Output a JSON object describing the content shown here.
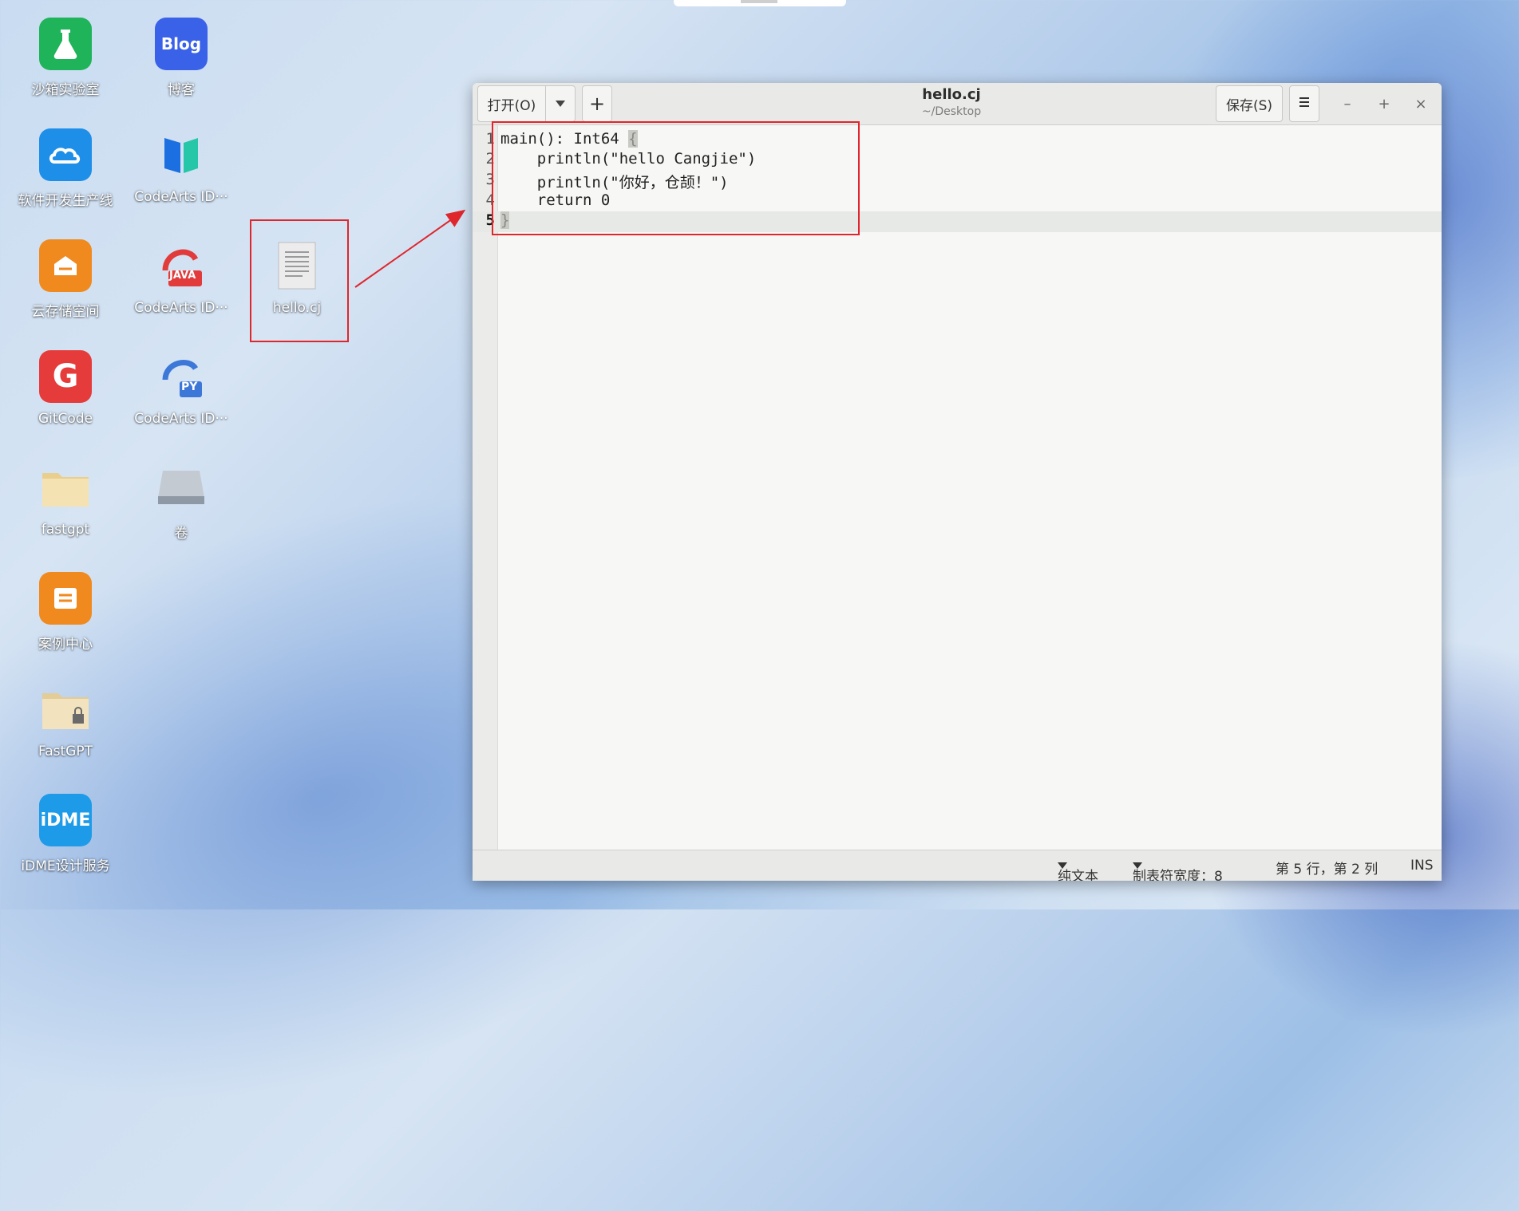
{
  "desktop": {
    "icons": [
      {
        "label": "沙箱实验室",
        "icon": "lab-flask-icon",
        "color": "#1fb35a"
      },
      {
        "label": "博客",
        "icon": "blog-icon",
        "color": "#3a62e8",
        "glyph": "Blog"
      },
      {
        "label": "软件开发生产线",
        "icon": "cloud-devops-icon",
        "color": "#1e8fe8"
      },
      {
        "label": "CodeArts ID···",
        "icon": "codearts-ide-icon",
        "color": "#1fa7d8"
      },
      {
        "label": "云存储空间",
        "icon": "cloud-storage-icon",
        "color": "#f08a1e"
      },
      {
        "label": "CodeArts ID···",
        "icon": "codearts-java-icon",
        "color": "#e83a3a",
        "glyph": "JAVA"
      },
      {
        "label": "hello.cj",
        "icon": "text-file-icon",
        "color": "#e6e6e6"
      },
      {
        "label": "GitCode",
        "icon": "gitcode-icon",
        "color": "#e63b3b",
        "glyph": "G"
      },
      {
        "label": "CodeArts ID···",
        "icon": "codearts-python-icon",
        "color": "#3d78d8",
        "glyph": "PY"
      },
      {
        "label": "fastgpt",
        "icon": "folder-icon",
        "color": "#f1d9a0"
      },
      {
        "label": "卷",
        "icon": "drive-icon",
        "color": "#b9c1c9"
      },
      {
        "label": "案例中心",
        "icon": "case-center-icon",
        "color": "#f08a1e"
      },
      {
        "label": "FastGPT",
        "icon": "locked-folder-icon",
        "color": "#efdcb0"
      },
      {
        "label": "iDME设计服务",
        "icon": "idme-icon",
        "color": "#1e9be8",
        "glyph": "iDME"
      }
    ]
  },
  "editor_window": {
    "open_button": "打开(O)",
    "new_tab_button": "+",
    "title": "hello.cj",
    "subtitle": "~/Desktop",
    "save_button": "保存(S)",
    "menu_icon": "hamburger-menu-icon",
    "minimize": "–",
    "maximize": "+",
    "close": "×",
    "lines": [
      {
        "num": "1",
        "code": "main(): Int64 ",
        "tail": "{"
      },
      {
        "num": "2",
        "code": "    println(\"hello Cangjie\")"
      },
      {
        "num": "3",
        "code": "    println(\"你好，仓颉！\")"
      },
      {
        "num": "4",
        "code": "    return 0"
      },
      {
        "num": "5",
        "code": "",
        "tail": "}"
      }
    ],
    "status": {
      "language": "纯文本",
      "tab_width": "制表符宽度：8",
      "position": "第 5 行，第 2 列",
      "mode": "INS"
    }
  },
  "annotation_color": "#e0262d"
}
